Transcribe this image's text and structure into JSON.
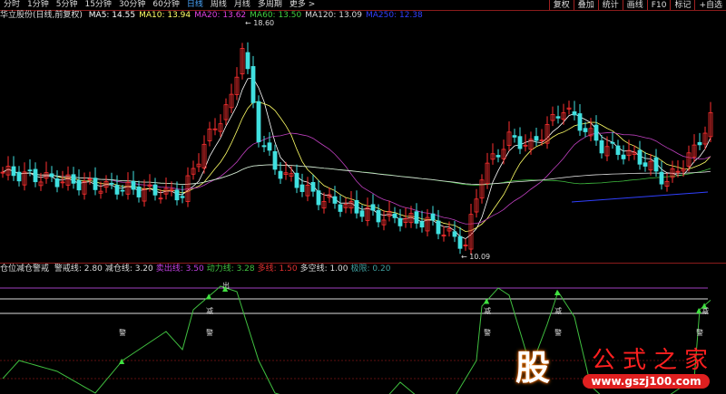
{
  "toolbar": {
    "periods": [
      "分时",
      "1分钟",
      "5分钟",
      "15分钟",
      "30分钟",
      "60分钟",
      "日线",
      "周线",
      "月线",
      "多周期",
      "更多 >"
    ],
    "active": "日线",
    "right": [
      "复权",
      "叠加",
      "统计",
      "画线",
      "F10",
      "标记",
      "+自选"
    ]
  },
  "stock": {
    "title": "华立股份(日线,前复权)",
    "ma": [
      {
        "label": "MA5: 14.55",
        "color": "#ffffff"
      },
      {
        "label": "MA10: 13.94",
        "color": "#ffff66"
      },
      {
        "label": "MA20: 13.62",
        "color": "#e040e0"
      },
      {
        "label": "MA60: 13.50",
        "color": "#40d040"
      },
      {
        "label": "MA120: 13.09",
        "color": "#dddddd"
      },
      {
        "label": "MA250: 12.38",
        "color": "#3040ff"
      }
    ],
    "high_label": "18.60",
    "low_label": "10.09"
  },
  "indicator": {
    "name": "仓位减仓警戒",
    "items": [
      {
        "label": "警戒线: 2.80",
        "color": "#dddddd"
      },
      {
        "label": "减仓线: 3.20",
        "color": "#dddddd"
      },
      {
        "label": "卖出线: 3.50",
        "color": "#c040e0"
      },
      {
        "label": "动力线: 3.28",
        "color": "#40c040"
      },
      {
        "label": "多线: 1.50",
        "color": "#e03030"
      },
      {
        "label": "多空线: 1.00",
        "color": "#dddddd"
      },
      {
        "label": "极限: 0.20",
        "color": "#40a0a0"
      }
    ],
    "levels": [
      3.5,
      3.2,
      2.8,
      1.5,
      1.0,
      0.2
    ],
    "signals": {
      "warn": "警",
      "reduce": "减",
      "sell": "出"
    }
  },
  "chart_data": {
    "type": "candlestick",
    "price_keypoints": [
      [
        0,
        13.15
      ],
      [
        17,
        12.66
      ],
      [
        33,
        12.33
      ],
      [
        37,
        14.15
      ],
      [
        42,
        15.8
      ],
      [
        44,
        17.8
      ],
      [
        47,
        14.5
      ],
      [
        50,
        13.3
      ],
      [
        58,
        12.2
      ],
      [
        70,
        11.5
      ],
      [
        78,
        11.35
      ],
      [
        85,
        10.5
      ],
      [
        88,
        13.1
      ],
      [
        93,
        14.4
      ],
      [
        97,
        14.1
      ],
      [
        103,
        15.5
      ],
      [
        110,
        14.1
      ],
      [
        117,
        13.65
      ],
      [
        122,
        12.8
      ],
      [
        127,
        13.95
      ],
      [
        130,
        15.1
      ]
    ],
    "power_keypoints": [
      [
        0,
        1.0
      ],
      [
        3,
        1.5
      ],
      [
        10,
        1.2
      ],
      [
        17,
        0.6
      ],
      [
        22,
        1.5
      ],
      [
        27,
        2.0
      ],
      [
        30,
        2.3
      ],
      [
        33,
        1.8
      ],
      [
        35,
        2.9
      ],
      [
        40,
        3.55
      ],
      [
        43,
        3.4
      ],
      [
        47,
        1.5
      ],
      [
        50,
        0.6
      ],
      [
        57,
        0.3
      ],
      [
        63,
        0.1
      ],
      [
        70,
        0.4
      ],
      [
        73,
        0.9
      ],
      [
        77,
        0.4
      ],
      [
        83,
        0.5
      ],
      [
        87,
        1.5
      ],
      [
        88,
        3.0
      ],
      [
        91,
        3.5
      ],
      [
        93,
        3.3
      ],
      [
        97,
        1.3
      ],
      [
        100,
        2.5
      ],
      [
        102,
        3.4
      ],
      [
        105,
        2.7
      ],
      [
        108,
        0.8
      ],
      [
        113,
        0.1
      ],
      [
        120,
        0.3
      ],
      [
        127,
        1.0
      ],
      [
        128,
        2.9
      ],
      [
        131,
        3.3
      ]
    ]
  },
  "watermark": {
    "logo": "股",
    "name": "公式之家",
    "url": "www.gszj100.com"
  }
}
